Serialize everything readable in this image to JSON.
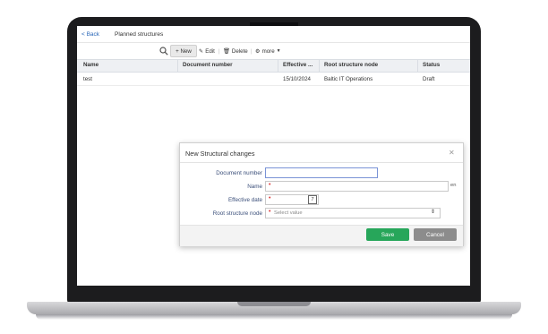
{
  "header": {
    "back_label": "< Back",
    "page_title": "Planned structures"
  },
  "toolbar": {
    "new_label": "+ New",
    "edit_label": "Edit",
    "delete_label": "Delete",
    "more_label": "more"
  },
  "table": {
    "columns": [
      "Name",
      "Document number",
      "Effective ...",
      "Root structure node",
      "Status"
    ],
    "rows": [
      {
        "name": "test",
        "document_number": "",
        "effective": "15/10/2024",
        "root_node": "Baltic IT Operations",
        "status": "Draft"
      }
    ]
  },
  "modal": {
    "title": "New Structural changes",
    "fields": {
      "document_number_label": "Document number",
      "name_label": "Name",
      "name_suffix": "en",
      "effective_date_label": "Effective date",
      "root_node_label": "Root structure node",
      "root_node_placeholder": "Select value"
    },
    "save_label": "Save",
    "cancel_label": "Cancel"
  },
  "colors": {
    "accent": "#2a67b8",
    "save": "#27a65a",
    "cancel": "#8c8c8c"
  }
}
